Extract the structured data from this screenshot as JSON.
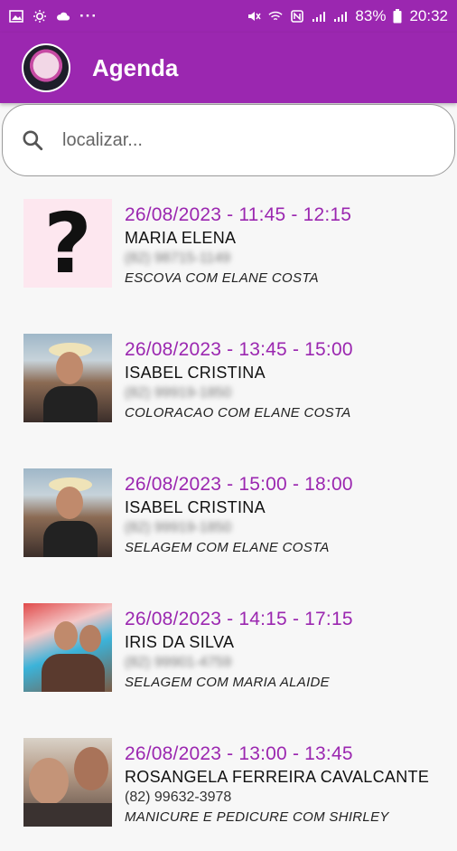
{
  "status_bar": {
    "battery": "83%",
    "clock": "20:32",
    "left_icons": [
      "image-icon",
      "brightness-icon",
      "cloud-icon",
      "more-dots-icon"
    ],
    "right_icons": [
      "mute-icon",
      "wifi-icon",
      "nfc-icon",
      "signal-icon",
      "battery-icon"
    ]
  },
  "header": {
    "title": "Agenda",
    "brand_color": "#9b27b0"
  },
  "search": {
    "placeholder": "localizar..."
  },
  "appointments": [
    {
      "time": "26/08/2023 - 11:45 - 12:15",
      "name": "MARIA ELENA",
      "phone": "(82) 98715-1149",
      "service": "ESCOVA COM ELANE COSTA",
      "photo": "question-mark-placeholder",
      "photo_text": "?"
    },
    {
      "time": "26/08/2023 - 13:45 - 15:00",
      "name": "ISABEL CRISTINA",
      "phone": "(82) 99919-1850",
      "service": "COLORACAO COM ELANE COSTA",
      "photo": "photo"
    },
    {
      "time": "26/08/2023 - 15:00 - 18:00",
      "name": "ISABEL CRISTINA",
      "phone": "(82) 99919-1850",
      "service": "SELAGEM COM ELANE COSTA",
      "photo": "photo"
    },
    {
      "time": "26/08/2023 - 14:15 - 17:15",
      "name": "IRIS DA SILVA",
      "phone": "(82) 99901-4759",
      "service": "SELAGEM COM MARIA  ALAIDE",
      "photo": "photo"
    },
    {
      "time": "26/08/2023 - 13:00 - 13:45",
      "name": "ROSANGELA FERREIRA CAVALCANTE",
      "phone": "(82) 99632-3978",
      "service": "MANICURE E PEDICURE COM SHIRLEY",
      "photo": "photo"
    }
  ]
}
